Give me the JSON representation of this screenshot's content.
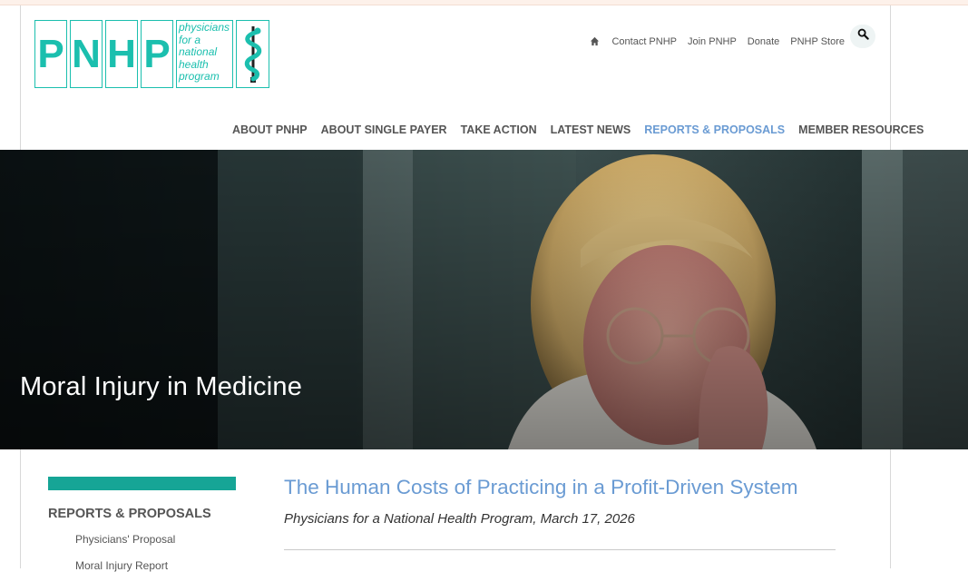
{
  "logo": {
    "letters": [
      "P",
      "N",
      "H",
      "P"
    ],
    "tagline_lines": [
      "physicians",
      "for a",
      "national",
      "health",
      "program"
    ]
  },
  "utility_nav": {
    "items": [
      "Contact PNHP",
      "Join PNHP",
      "Donate",
      "PNHP Store"
    ]
  },
  "main_nav": {
    "items": [
      "ABOUT PNHP",
      "ABOUT SINGLE PAYER",
      "TAKE ACTION",
      "LATEST NEWS",
      "REPORTS & PROPOSALS",
      "MEMBER RESOURCES"
    ],
    "active": "REPORTS & PROPOSALS"
  },
  "hero": {
    "title": "Moral Injury in Medicine"
  },
  "sidebar": {
    "heading": "REPORTS & PROPOSALS",
    "links": [
      "Physicians' Proposal",
      "Moral Injury Report"
    ]
  },
  "article": {
    "title": "The Human Costs of Practicing in a Profit-Driven System",
    "byline": "Physicians for a National Health Program, March 17, 2026"
  },
  "colors": {
    "teal": "#1bbfae",
    "sidebar_bar": "#16a596",
    "link_blue": "#6a9bd3",
    "nav_gray": "#555555"
  },
  "icons": [
    "home-icon",
    "search-icon",
    "caduceus-icon"
  ]
}
